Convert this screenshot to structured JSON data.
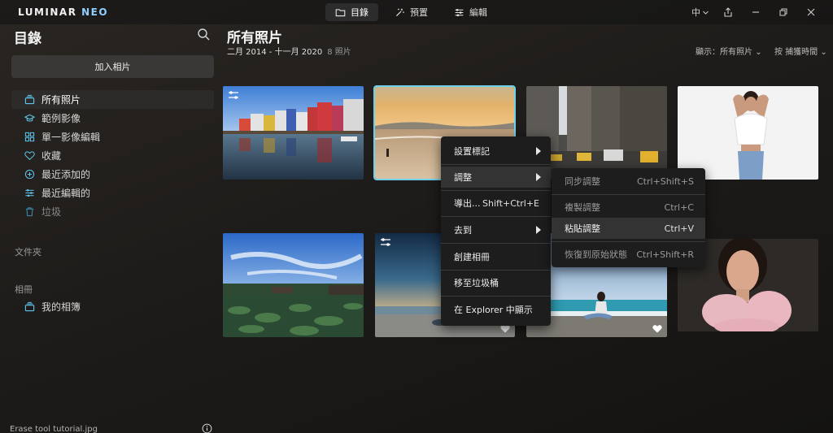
{
  "app": {
    "logo_main": "LUMINAR",
    "logo_accent": "NEO"
  },
  "top_tabs": [
    {
      "label": "目錄",
      "icon": "folder-icon"
    },
    {
      "label": "預置",
      "icon": "magic-wand-icon"
    },
    {
      "label": "編輯",
      "icon": "sliders-icon"
    }
  ],
  "window": {
    "language": "中"
  },
  "sidebar": {
    "title": "目錄",
    "add_button": "加入相片",
    "nav_items": [
      {
        "label": "所有照片",
        "icon": "photos-stack-icon"
      },
      {
        "label": "範例影像",
        "icon": "graduation-cap-icon"
      },
      {
        "label": "單一影像編輯",
        "icon": "grid-icon"
      },
      {
        "label": "收藏",
        "icon": "heart-icon"
      },
      {
        "label": "最近添加的",
        "icon": "plus-circle-icon"
      },
      {
        "label": "最近編輯的",
        "icon": "sliders-icon"
      },
      {
        "label": "垃圾",
        "icon": "trash-icon"
      }
    ],
    "folders_label": "文件夾",
    "albums_label": "相冊",
    "album_item": "我的相簿",
    "footer_file": "Erase tool tutorial.jpg"
  },
  "main": {
    "title": "所有照片",
    "date_range": "二月 2014 - 十一月 2020",
    "photo_count": "8 照片",
    "show_filter": "顯示：所有照片",
    "sort": "按 捕獲時間"
  },
  "context_menu": {
    "items": [
      {
        "label": "設置標記",
        "shortcut": "",
        "submenu": true
      },
      {
        "label": "調整",
        "shortcut": "",
        "submenu": true
      },
      {
        "label": "導出...",
        "shortcut": "Shift+Ctrl+E",
        "submenu": false
      },
      {
        "label": "去到",
        "shortcut": "",
        "submenu": true
      },
      {
        "label": "創建相冊",
        "shortcut": "",
        "submenu": false
      },
      {
        "label": "移至垃圾桶",
        "shortcut": "",
        "submenu": false
      },
      {
        "label": "在 Explorer 中顯示",
        "shortcut": "",
        "submenu": false
      }
    ]
  },
  "submenu": {
    "items": [
      {
        "label": "同步調整",
        "shortcut": "Ctrl+Shift+S"
      },
      {
        "label": "複製調整",
        "shortcut": "Ctrl+C"
      },
      {
        "label": "粘貼調整",
        "shortcut": "Ctrl+V"
      },
      {
        "label": "恢復到原始狀態",
        "shortcut": "Ctrl+Shift+R"
      }
    ]
  },
  "colors": {
    "accent": "#6fd0ec",
    "menu_bg": "#1d1d1d",
    "menu_highlight": "#333333"
  }
}
